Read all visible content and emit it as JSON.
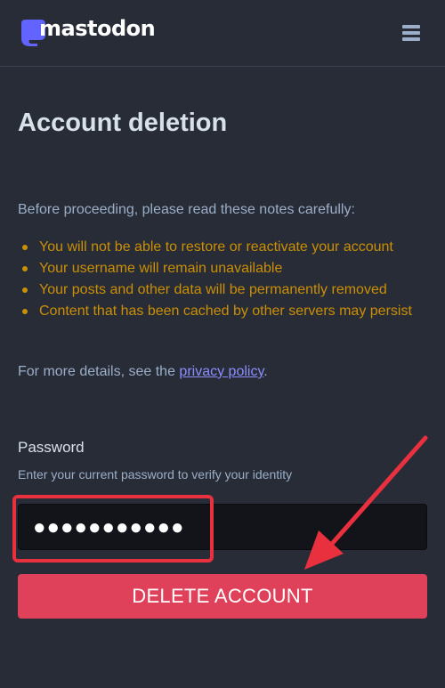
{
  "header": {
    "logo_text": "mastodon",
    "logo_icon": "mastodon-logo-icon",
    "menu_icon": "hamburger-menu-icon"
  },
  "main": {
    "title": "Account deletion",
    "intro": "Before proceeding, please read these notes carefully:",
    "warnings": [
      "You will not be able to restore or reactivate your account",
      "Your username will remain unavailable",
      "Your posts and other data will be permanently removed",
      "Content that has been cached by other servers may persist"
    ],
    "details_prefix": "For more details, see the ",
    "privacy_link": "privacy policy",
    "details_suffix": "."
  },
  "form": {
    "password_label": "Password",
    "password_hint": "Enter your current password to verify your identity",
    "password_value": "●●●●●●●●●●●",
    "delete_button": "DELETE ACCOUNT"
  },
  "colors": {
    "background": "#282c37",
    "warning": "#ca8f04",
    "link": "#8c8dff",
    "danger_button": "#df405a",
    "annotation": "#e8303e"
  }
}
